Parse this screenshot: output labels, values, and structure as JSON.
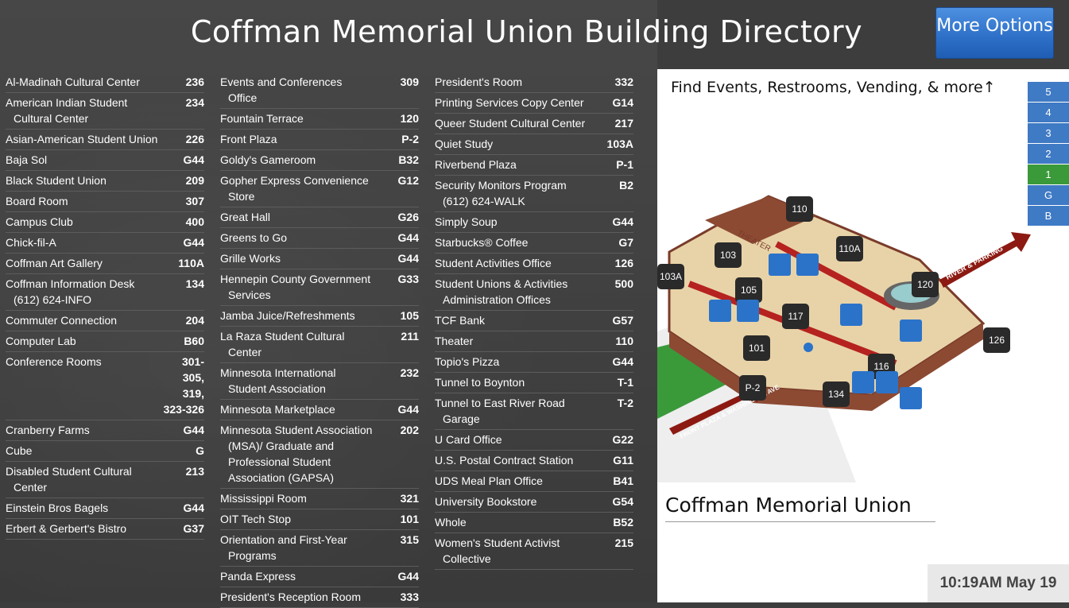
{
  "header": {
    "title": "Coffman Memorial Union Building Directory",
    "more_options": "More Options"
  },
  "directory": {
    "col1": [
      {
        "name": "Al-Madinah Cultural Center",
        "room": "236"
      },
      {
        "name": "American Indian Student",
        "name2": "Cultural Center",
        "room": "234"
      },
      {
        "name": "Asian-American Student Union",
        "room": "226"
      },
      {
        "name": "Baja Sol",
        "room": "G44"
      },
      {
        "name": "Black Student Union",
        "room": "209"
      },
      {
        "name": "Board Room",
        "room": "307"
      },
      {
        "name": "Campus Club",
        "room": "400"
      },
      {
        "name": "Chick-fil-A",
        "room": "G44"
      },
      {
        "name": "Coffman Art Gallery",
        "room": "110A"
      },
      {
        "name": "Coffman Information Desk",
        "name2": "(612) 624-INFO",
        "room": "134"
      },
      {
        "name": "Commuter Connection",
        "room": "204"
      },
      {
        "name": "Computer Lab",
        "room": "B60"
      },
      {
        "name": "Conference Rooms",
        "room": "301-\n305,\n319,\n323-326"
      },
      {
        "name": "Cranberry Farms",
        "room": "G44"
      },
      {
        "name": "Cube",
        "room": "G"
      },
      {
        "name": "Disabled Student Cultural",
        "name2": "Center",
        "room": "213"
      },
      {
        "name": "Einstein Bros Bagels",
        "room": "G44"
      },
      {
        "name": "Erbert & Gerbert's Bistro",
        "room": "G37"
      }
    ],
    "col2": [
      {
        "name": "Events and Conferences",
        "name2": "Office",
        "room": "309"
      },
      {
        "name": "Fountain Terrace",
        "room": "120"
      },
      {
        "name": "Front Plaza",
        "room": "P-2"
      },
      {
        "name": "Goldy's Gameroom",
        "room": "B32"
      },
      {
        "name": "Gopher Express Convenience",
        "name2": "Store",
        "room": "G12"
      },
      {
        "name": "Great Hall",
        "room": "G26"
      },
      {
        "name": "Greens to Go",
        "room": "G44"
      },
      {
        "name": "Grille Works",
        "room": "G44"
      },
      {
        "name": "Hennepin County Government",
        "name2": "Services",
        "room": "G33"
      },
      {
        "name": "Jamba Juice/Refreshments",
        "room": "105"
      },
      {
        "name": "La Raza Student Cultural",
        "name2": "Center",
        "room": "211"
      },
      {
        "name": "Minnesota International",
        "name2": "Student Association",
        "room": "232"
      },
      {
        "name": "Minnesota Marketplace",
        "room": "G44"
      },
      {
        "name": "Minnesota Student Association",
        "name2": "(MSA)/ Graduate and",
        "name3": "Professional Student",
        "name4": "Association (GAPSA)",
        "room": "202"
      },
      {
        "name": "Mississippi Room",
        "room": "321"
      },
      {
        "name": "OIT Tech Stop",
        "room": "101"
      },
      {
        "name": "Orientation and First-Year",
        "name2": "Programs",
        "room": "315"
      },
      {
        "name": "Panda Express",
        "room": "G44"
      },
      {
        "name": "President's Reception Room",
        "room": "333"
      }
    ],
    "col3": [
      {
        "name": "President's Room",
        "room": "332"
      },
      {
        "name": "Printing Services Copy Center",
        "room": "G14"
      },
      {
        "name": "Queer Student Cultural Center",
        "room": "217"
      },
      {
        "name": "Quiet Study",
        "room": "103A"
      },
      {
        "name": "Riverbend Plaza",
        "room": "P-1"
      },
      {
        "name": "Security Monitors Program",
        "name2": "(612) 624-WALK",
        "room": "B2"
      },
      {
        "name": "Simply Soup",
        "room": "G44"
      },
      {
        "name": "Starbucks® Coffee",
        "room": "G7"
      },
      {
        "name": "Student Activities Office",
        "room": "126"
      },
      {
        "name": "Student Unions & Activities",
        "name2": "Administration Offices",
        "room": "500"
      },
      {
        "name": "TCF Bank",
        "room": "G57"
      },
      {
        "name": "Theater",
        "room": "110"
      },
      {
        "name": "Topio's Pizza",
        "room": "G44"
      },
      {
        "name": "Tunnel to Boynton",
        "room": "T-1"
      },
      {
        "name": "Tunnel to East River Road",
        "name2": "Garage",
        "room": "T-2"
      },
      {
        "name": "U Card Office",
        "room": "G22"
      },
      {
        "name": "U.S. Postal Contract Station",
        "room": "G11"
      },
      {
        "name": "UDS Meal Plan Office",
        "room": "B41"
      },
      {
        "name": "University Bookstore",
        "room": "G54"
      },
      {
        "name": "Whole",
        "room": "B52"
      },
      {
        "name": "Women's Student Activist",
        "name2": "Collective",
        "room": "215"
      }
    ]
  },
  "map": {
    "header": "Find Events, Restrooms, Vending, & more",
    "floors": [
      "5",
      "4",
      "3",
      "2",
      "1",
      "G",
      "B"
    ],
    "active_floor": "1",
    "room_markers": [
      "110",
      "103",
      "105",
      "110A",
      "120",
      "117",
      "101",
      "126",
      "116",
      "P-2",
      "134",
      "103A"
    ],
    "labels": {
      "theater": "THEATER",
      "river": "RIVER & PARKING",
      "plaza": "FRONT PLAZA & WASHINGTON AVE"
    },
    "building_name": "Coffman Memorial Union",
    "clock": "10:19AM May 19"
  },
  "colors": {
    "accent_blue": "#3f7ac4",
    "active_floor": "#3a9a3a",
    "background": "#3d3d3d"
  }
}
